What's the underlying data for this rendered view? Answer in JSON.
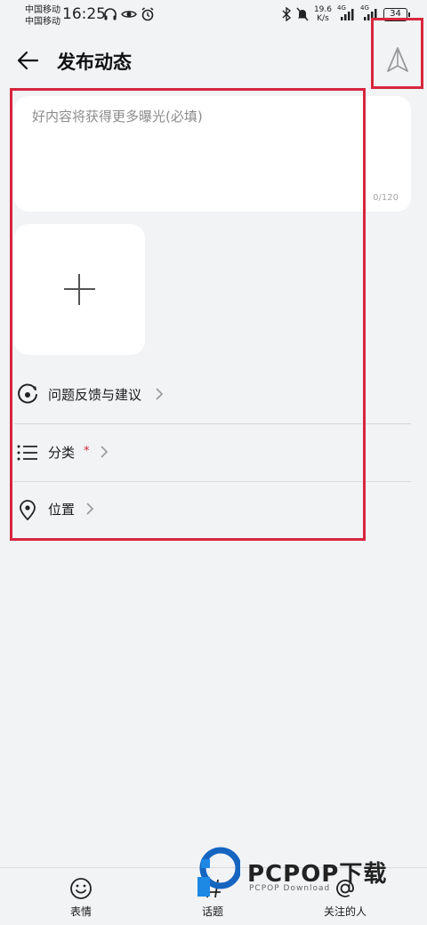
{
  "status_bar": {
    "carrier_1": "中国移动",
    "carrier_2": "中国移动",
    "time": "16:25",
    "net_speed_value": "19.6",
    "net_speed_unit": "K/s",
    "signal_1": "4G",
    "signal_2": "4G",
    "battery": "34"
  },
  "header": {
    "title": "发布动态"
  },
  "editor": {
    "placeholder": "好内容将获得更多曝光(必填)",
    "char_count": "0/120"
  },
  "options": {
    "feedback_label": "问题反馈与建议",
    "category_label": "分类",
    "category_required": "*",
    "location_label": "位置"
  },
  "toolbar": {
    "emoji_label": "表情",
    "topic_label": "话题",
    "mention_label": "关注的人"
  },
  "watermark": {
    "brand": "PCPOP下载",
    "sub": "PCPOP Download"
  },
  "colors": {
    "highlight": "#d7263d",
    "background": "#f1f3f5"
  }
}
